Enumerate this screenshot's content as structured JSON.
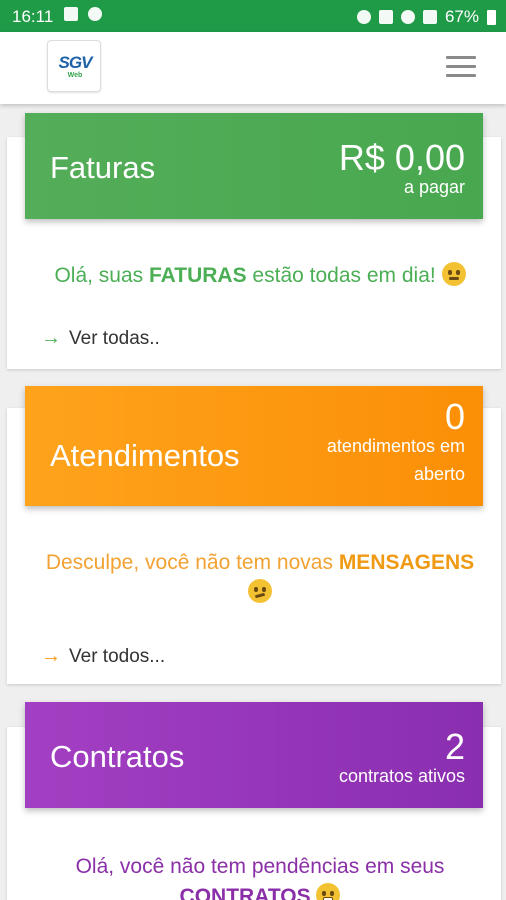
{
  "status_bar": {
    "time": "16:11",
    "battery": "67%"
  },
  "app": {
    "logo_text": "SGV",
    "logo_sub": "Web"
  },
  "colors": {
    "green": "#4cae55",
    "orange": "#fb9710",
    "purple": "#9b3dbb",
    "status": "#1f9a47"
  },
  "faturas": {
    "title": "Faturas",
    "value": "R$ 0,00",
    "value_caption": "a pagar",
    "message_pre": "Olá, suas ",
    "message_emph": "FATURAS",
    "message_post": " estão todas em dia!",
    "link": "Ver todas.."
  },
  "atendimentos": {
    "title": "Atendimentos",
    "value": "0",
    "value_caption_1": "atendimentos em",
    "value_caption_2": "aberto",
    "message_pre": "Desculpe, você não tem novas ",
    "message_emph": "MENSAGENS",
    "link": "Ver todos..."
  },
  "contratos": {
    "title": "Contratos",
    "value": "2",
    "value_caption": "contratos ativos",
    "message_pre": "Olá, você não tem pendências em seus",
    "message_emph": "CONTRATOS"
  }
}
